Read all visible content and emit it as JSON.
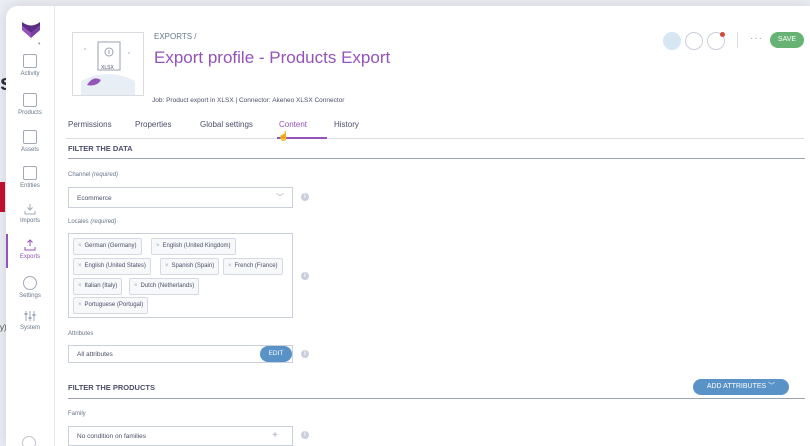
{
  "sidebar": {
    "items": [
      {
        "label": "Activity"
      },
      {
        "label": "Products"
      },
      {
        "label": "Assets"
      },
      {
        "label": "Entities"
      },
      {
        "label": "Imports"
      },
      {
        "label": "Exports"
      },
      {
        "label": "Settings"
      },
      {
        "label": "System"
      }
    ],
    "active": "Exports"
  },
  "header": {
    "breadcrumb": "EXPORTS /",
    "title": "Export profile - Products Export",
    "job_line": "Job: Product export in XLSX | Connector: Akeneo XLSX Connector",
    "thumbnail_label": "XLSX",
    "save_label": "SAVE",
    "more_label": "···"
  },
  "tabs": [
    {
      "label": "Permissions"
    },
    {
      "label": "Properties"
    },
    {
      "label": "Global settings"
    },
    {
      "label": "Content"
    },
    {
      "label": "History"
    }
  ],
  "active_tab": "Content",
  "filter_data": {
    "title": "FILTER THE DATA",
    "channel_label": "Channel",
    "channel_required": "(required)",
    "channel_value": "Ecommerce",
    "locales_label": "Locales",
    "locales_required": "(required)",
    "locales": [
      "German (Germany)",
      "English (United Kingdom)",
      "English (United States)",
      "Spanish (Spain)",
      "French (France)",
      "Italian (Italy)",
      "Dutch (Netherlands)",
      "Portuguese (Portugal)"
    ],
    "attributes_label": "Attributes",
    "attributes_value": "All attributes",
    "edit_label": "EDIT"
  },
  "filter_products": {
    "title": "FILTER THE PRODUCTS",
    "add_attributes_label": "ADD ATTRIBUTES",
    "family_label": "Family",
    "family_value": "No condition on families"
  },
  "background": {
    "fragment_s": "s",
    "fragment_y": "y)"
  },
  "colors": {
    "brand_purple": "#9452ba",
    "save_green": "#67b373",
    "action_blue": "#5992c7",
    "text": "#4b4e6b"
  }
}
